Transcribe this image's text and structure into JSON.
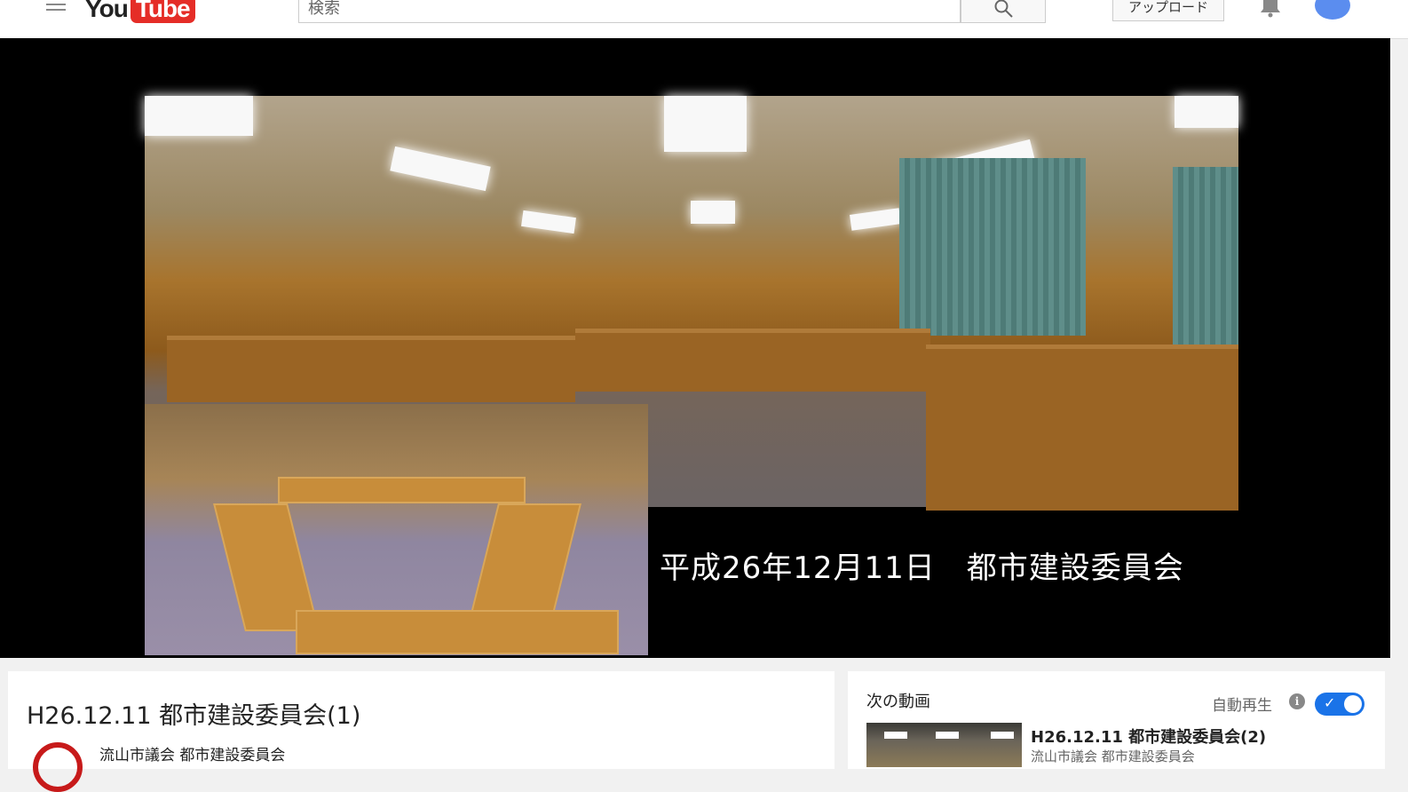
{
  "header": {
    "logo_you": "You",
    "logo_tube": "Tube",
    "search_placeholder": "検索",
    "upload_label": "アップロード"
  },
  "video": {
    "overlay_caption": "平成26年12月11日　都市建設委員会"
  },
  "info": {
    "title": "H26.12.11 都市建設委員会(1)",
    "channel_name": "流山市議会 都市建設委員会"
  },
  "sidebar": {
    "next_label": "次の動画",
    "autoplay_label": "自動再生",
    "autoplay_on": true,
    "next_video": {
      "title": "H26.12.11 都市建設委員会(2)",
      "channel": "流山市議会 都市建設委員会"
    }
  },
  "colors": {
    "brand_red": "#e52d27",
    "toggle_blue": "#1a73e8"
  }
}
